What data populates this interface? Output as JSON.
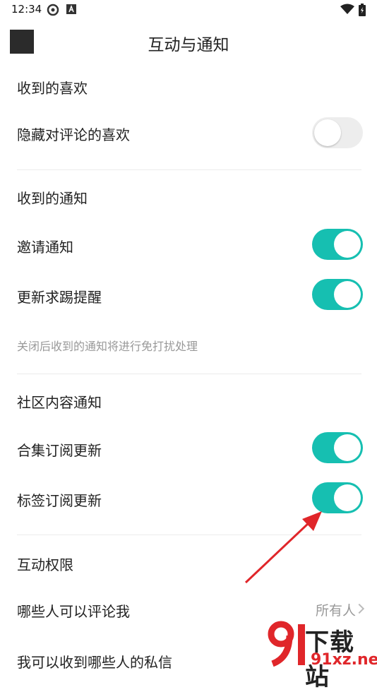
{
  "status_bar": {
    "time": "12:34"
  },
  "header": {
    "title": "互动与通知"
  },
  "sections": {
    "likes": {
      "title": "收到的喜欢",
      "hide_comment_likes": {
        "label": "隐藏对评论的喜欢",
        "enabled": false
      }
    },
    "notifications": {
      "title": "收到的通知",
      "invite": {
        "label": "邀请通知",
        "enabled": true
      },
      "update_request": {
        "label": "更新求踢提醒",
        "enabled": true
      },
      "hint": "关闭后收到的通知将进行免打扰处理"
    },
    "community": {
      "title": "社区内容通知",
      "collection_update": {
        "label": "合集订阅更新",
        "enabled": true
      },
      "tag_update": {
        "label": "标签订阅更新",
        "enabled": true
      }
    },
    "permissions": {
      "title": "互动权限",
      "who_can_comment": {
        "label": "哪些人可以评论我",
        "value": "所有人"
      },
      "who_can_message": {
        "label": "我可以收到哪些人的私信"
      }
    }
  },
  "watermark": {
    "text_main": "下载站",
    "text_site": "91xz.net"
  },
  "colors": {
    "toggle_on": "#16bfb1",
    "toggle_off": "#ededed",
    "annotation_arrow": "#e0262a"
  }
}
